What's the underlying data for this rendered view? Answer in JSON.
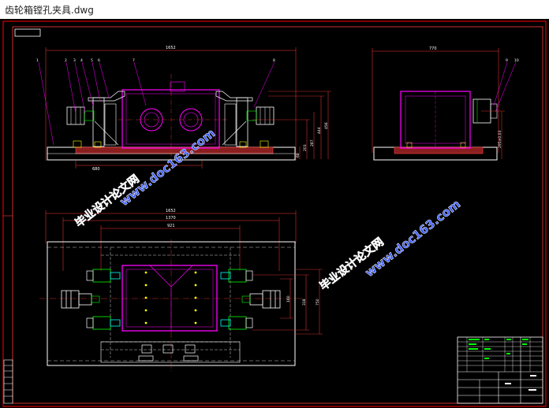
{
  "window": {
    "title": "齿轮箱镗孔夹具.dwg"
  },
  "colors": {
    "background": "#000000",
    "frame": "#ff0000",
    "dim": "#ff3b3b",
    "part": "#ffffff",
    "magenta": "#ff00ff",
    "green": "#00ff00",
    "cyan": "#00ffff",
    "yellow": "#ffff00",
    "watermark": "#3a5bff"
  },
  "front_view": {
    "dim_total": "1652",
    "dim_base": "680",
    "dims_right": [
      "68",
      "203",
      "287",
      "444",
      "456"
    ],
    "balloons": [
      "1",
      "2",
      "3",
      "4",
      "5",
      "6",
      "7",
      "8"
    ]
  },
  "side_view": {
    "dim_total": "770",
    "dim_height": "295±0.03",
    "balloons": [
      "9",
      "10"
    ]
  },
  "top_view": {
    "dims_top": [
      "1652",
      "1370",
      "921"
    ],
    "dims_right": [
      "160",
      "318",
      "750"
    ]
  },
  "watermarks": {
    "site1": "www.doc163.com",
    "cn1": "毕业设计论文网",
    "site2": "www.doc163.com",
    "cn2": "毕业设计论文网"
  }
}
